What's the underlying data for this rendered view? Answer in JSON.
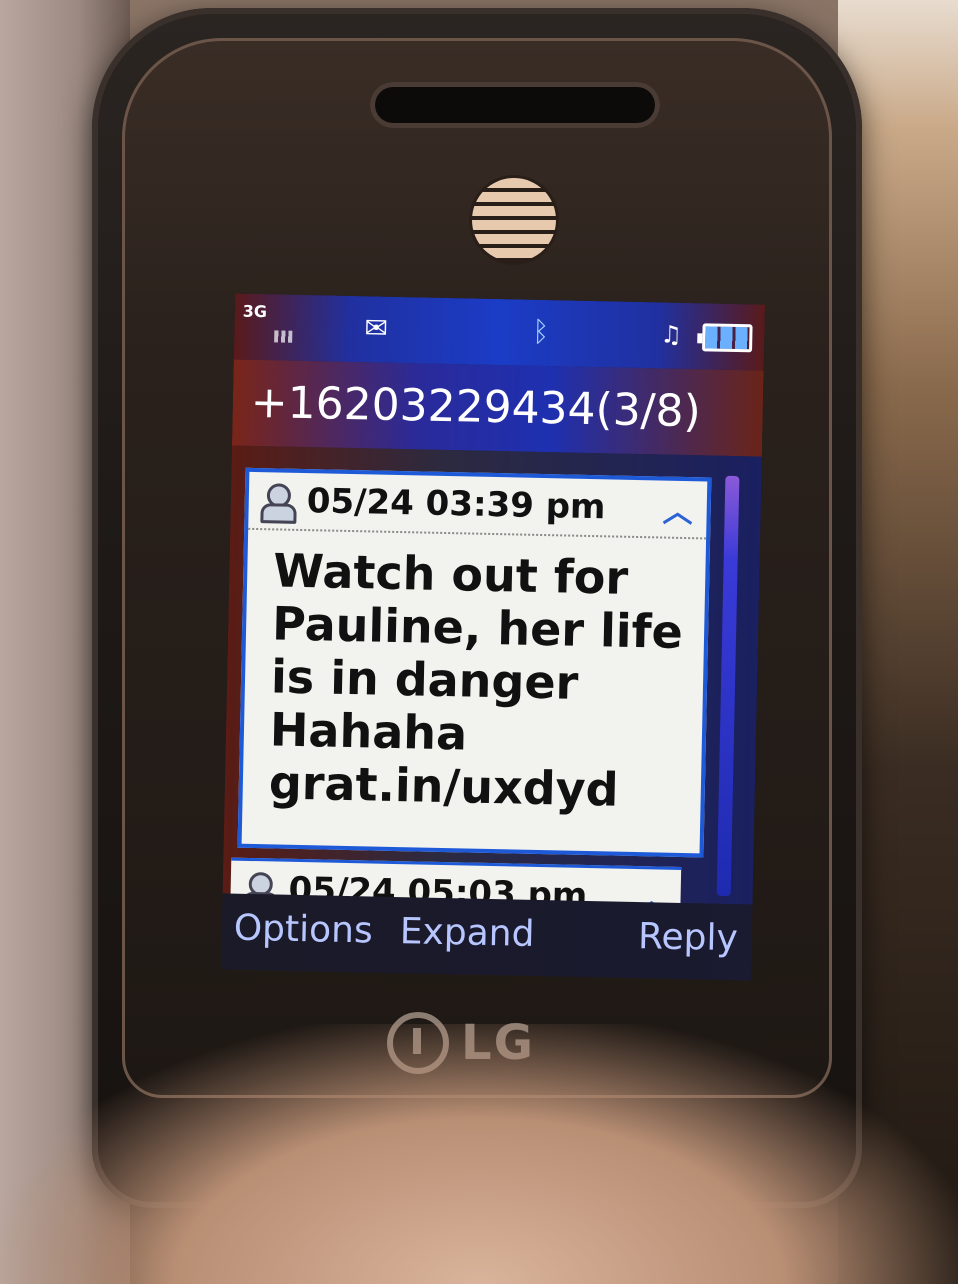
{
  "status_bar": {
    "network": "3G",
    "icons": [
      "signal-icon",
      "message-icon",
      "bluetooth-icon",
      "ringer-icon",
      "battery-icon"
    ]
  },
  "conversation": {
    "title": "+16203229434(3/8)"
  },
  "messages": [
    {
      "timestamp": "05/24 03:39 pm",
      "lines": [
        "Watch out for",
        "Pauline, her life",
        "is in danger",
        "Hahaha",
        "grat.in/uxdyd"
      ]
    },
    {
      "timestamp": "05/24 05:03 pm"
    }
  ],
  "softkeys": {
    "left": "Options",
    "center": "Expand",
    "right": "Reply"
  },
  "device": {
    "brand": "LG"
  },
  "colors": {
    "highlight_border": "#1e5ad8",
    "softkey_text": "#b8c6ff"
  }
}
